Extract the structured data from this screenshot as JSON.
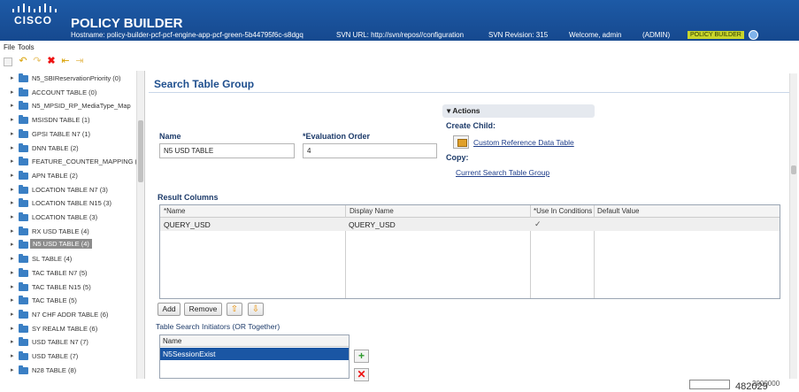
{
  "header": {
    "brand": "CISCO",
    "app_title": "POLICY BUILDER",
    "hostname": "Hostname: policy-builder-pcf-pcf-engine-app-pcf-green-5b44795f6c-s8dgq",
    "svn_url": "SVN URL: http://svn/repos//configuration",
    "svn_revision": "SVN Revision: 315",
    "welcome": "Welcome, admin",
    "role": "(ADMIN)",
    "mode_badge": "POLICY BUILDER"
  },
  "menu": {
    "file": "File",
    "tools": "Tools"
  },
  "tree": {
    "items": [
      {
        "label": "N5_SBIReservationPriority (0)"
      },
      {
        "label": "ACCOUNT TABLE (0)"
      },
      {
        "label": "N5_MPSID_RP_MediaType_Map"
      },
      {
        "label": "MSISDN TABLE (1)"
      },
      {
        "label": "GPSI TABLE N7 (1)"
      },
      {
        "label": "DNN TABLE (2)"
      },
      {
        "label": "FEATURE_COUNTER_MAPPING ("
      },
      {
        "label": "APN TABLE (2)"
      },
      {
        "label": "LOCATION TABLE N7 (3)"
      },
      {
        "label": "LOCATION TABLE N15 (3)"
      },
      {
        "label": "LOCATION TABLE (3)"
      },
      {
        "label": "RX USD TABLE (4)"
      },
      {
        "label": "N5 USD TABLE (4)"
      },
      {
        "label": "SL TABLE (4)"
      },
      {
        "label": "TAC TABLE N7 (5)"
      },
      {
        "label": "TAC TABLE N15 (5)"
      },
      {
        "label": "TAC TABLE (5)"
      },
      {
        "label": "N7 CHF ADDR TABLE (6)"
      },
      {
        "label": "SY REALM TABLE (6)"
      },
      {
        "label": "USD TABLE N7 (7)"
      },
      {
        "label": "USD TABLE (7)"
      },
      {
        "label": "N28 TABLE (8)"
      }
    ],
    "selected_index": 12
  },
  "main": {
    "title": "Search Table Group",
    "name_label": "Name",
    "name_value": "N5 USD TABLE",
    "eval_label": "*Evaluation Order",
    "eval_value": "4",
    "actions": {
      "header": "Actions",
      "create_child_label": "Create Child:",
      "create_child_link": "Custom Reference Data Table",
      "copy_label": "Copy:",
      "copy_link": "Current Search Table Group"
    },
    "result_columns": {
      "label": "Result Columns",
      "headers": [
        "*Name",
        "Display Name",
        "*Use In Conditions",
        "Default Value"
      ],
      "rows": [
        {
          "name": "QUERY_USD",
          "display": "QUERY_USD",
          "use_in_conditions": true,
          "default": ""
        }
      ]
    },
    "buttons": {
      "add": "Add",
      "remove": "Remove"
    },
    "initiators": {
      "label": "Table Search Initiators (OR Together)",
      "header": "Name",
      "items": [
        "N5SessionExist"
      ]
    }
  },
  "status": {
    "count": "482029",
    "extra": "2000000"
  },
  "colors": {
    "header_blue": "#1d5aa6",
    "selection_blue": "#1a56a4",
    "title_blue": "#1f4f8e",
    "badge": "#c8d52b"
  }
}
